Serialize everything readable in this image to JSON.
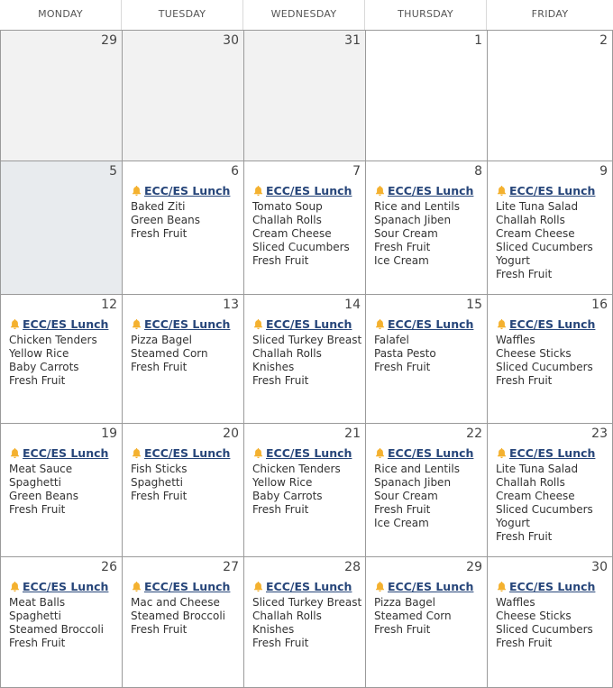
{
  "headers": [
    "MONDAY",
    "TUESDAY",
    "WEDNESDAY",
    "THURSDAY",
    "FRIDAY"
  ],
  "event_label": "ECC/ES Lunch",
  "weeks": [
    [
      {
        "date": "29",
        "items": []
      },
      {
        "date": "30",
        "items": []
      },
      {
        "date": "31",
        "items": []
      },
      {
        "date": "1",
        "items": []
      },
      {
        "date": "2",
        "items": []
      }
    ],
    [
      {
        "date": "5",
        "items": []
      },
      {
        "date": "6",
        "items": [
          "Baked Ziti",
          "Green Beans",
          "Fresh Fruit"
        ]
      },
      {
        "date": "7",
        "items": [
          "Tomato Soup",
          "Challah Rolls",
          "Cream Cheese",
          "Sliced Cucumbers",
          "Fresh Fruit"
        ]
      },
      {
        "date": "8",
        "items": [
          "Rice and Lentils",
          "Spanach Jiben",
          "Sour Cream",
          "Fresh Fruit",
          "Ice Cream"
        ]
      },
      {
        "date": "9",
        "items": [
          "Lite Tuna Salad",
          "Challah Rolls",
          "Cream Cheese",
          "Sliced Cucumbers",
          "Yogurt",
          "Fresh Fruit"
        ]
      }
    ],
    [
      {
        "date": "12",
        "items": [
          "Chicken Tenders",
          "Yellow Rice",
          "Baby Carrots",
          "Fresh Fruit"
        ]
      },
      {
        "date": "13",
        "items": [
          "Pizza Bagel",
          "Steamed Corn",
          "Fresh Fruit"
        ]
      },
      {
        "date": "14",
        "items": [
          "Sliced Turkey Breast",
          "Challah Rolls",
          "Knishes",
          "Fresh Fruit"
        ]
      },
      {
        "date": "15",
        "items": [
          "Falafel",
          "Pasta Pesto",
          "Fresh Fruit"
        ]
      },
      {
        "date": "16",
        "items": [
          "Waffles",
          "Cheese Sticks",
          "Sliced Cucumbers",
          "Fresh Fruit"
        ]
      }
    ],
    [
      {
        "date": "19",
        "items": [
          "Meat Sauce",
          "Spaghetti",
          "Green Beans",
          "Fresh Fruit"
        ]
      },
      {
        "date": "20",
        "items": [
          "Fish Sticks",
          "Spaghetti",
          "Fresh Fruit"
        ]
      },
      {
        "date": "21",
        "items": [
          "Chicken Tenders",
          "Yellow Rice",
          "Baby Carrots",
          "Fresh Fruit"
        ]
      },
      {
        "date": "22",
        "items": [
          "Rice and Lentils",
          "Spanach Jiben",
          "Sour Cream",
          "Fresh Fruit",
          "Ice Cream"
        ]
      },
      {
        "date": "23",
        "items": [
          "Lite Tuna Salad",
          "Challah Rolls",
          "Cream Cheese",
          "Sliced Cucumbers",
          "Yogurt",
          "Fresh Fruit"
        ]
      }
    ],
    [
      {
        "date": "26",
        "items": [
          "Meat Balls",
          "Spaghetti",
          "Steamed Broccoli",
          "Fresh Fruit"
        ]
      },
      {
        "date": "27",
        "items": [
          "Mac and Cheese",
          "Steamed Broccoli",
          "Fresh Fruit"
        ]
      },
      {
        "date": "28",
        "items": [
          "Sliced Turkey Breast",
          "Challah Rolls",
          "Knishes",
          "Fresh Fruit"
        ]
      },
      {
        "date": "29",
        "items": [
          "Pizza Bagel",
          "Steamed Corn",
          "Fresh Fruit"
        ]
      },
      {
        "date": "30",
        "items": [
          "Waffles",
          "Cheese Sticks",
          "Sliced Cucumbers",
          "Fresh Fruit"
        ]
      }
    ]
  ],
  "colors": {
    "event_link": "#27467a",
    "bell": "#f4b12f",
    "outside_month_bg": "#f2f2f2",
    "no_school_bg": "#e8ebee"
  },
  "icons": {
    "event": "bell-icon"
  }
}
